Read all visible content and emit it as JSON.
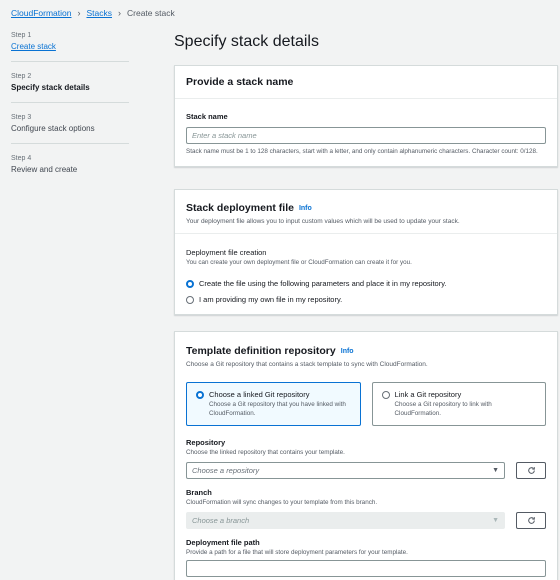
{
  "breadcrumb": {
    "items": [
      {
        "label": "CloudFormation"
      },
      {
        "label": "Stacks"
      }
    ],
    "current": "Create stack"
  },
  "steps": [
    {
      "num": "Step 1",
      "label": "Create stack"
    },
    {
      "num": "Step 2",
      "label": "Specify stack details"
    },
    {
      "num": "Step 3",
      "label": "Configure stack options"
    },
    {
      "num": "Step 4",
      "label": "Review and create"
    }
  ],
  "page_title": "Specify stack details",
  "stack_name": {
    "header": "Provide a stack name",
    "label": "Stack name",
    "placeholder": "Enter a stack name",
    "hint": "Stack name must be 1 to 128 characters, start with a letter, and only contain alphanumeric characters. Character count: 0/128."
  },
  "deployment": {
    "header": "Stack deployment file",
    "info": "Info",
    "desc": "Your deployment file allows you to input custom values which will be used to update your stack.",
    "label": "Deployment file creation",
    "sub": "You can create your own deployment file or CloudFormation can create it for you.",
    "options": [
      {
        "label": "Create the file using the following parameters and place it in my repository.",
        "selected": true
      },
      {
        "label": "I am providing my own file in my repository.",
        "selected": false
      }
    ]
  },
  "template_repo": {
    "header": "Template definition repository",
    "info": "Info",
    "desc": "Choose a Git repository that contains a stack template to sync with CloudFormation.",
    "tiles": [
      {
        "title": "Choose a linked Git repository",
        "desc": "Choose a Git repository that you have linked with CloudFormation.",
        "selected": true
      },
      {
        "title": "Link a Git repository",
        "desc": "Choose a Git repository to link with CloudFormation.",
        "selected": false
      }
    ],
    "repository": {
      "label": "Repository",
      "desc": "Choose the linked repository that contains your template.",
      "placeholder": "Choose a repository"
    },
    "branch": {
      "label": "Branch",
      "desc": "CloudFormation will sync changes to your template from this branch.",
      "placeholder": "Choose a branch"
    },
    "deploy_path": {
      "label": "Deployment file path",
      "desc": "Provide a path for a file that will store deployment parameters for your template."
    }
  },
  "colors": {
    "accent": "#0972d3",
    "background": "#f2f3f3"
  },
  "icons": {
    "breadcrumb_separator": "chevron-right-icon",
    "refresh": "refresh-icon",
    "dropdown": "caret-down-icon"
  }
}
